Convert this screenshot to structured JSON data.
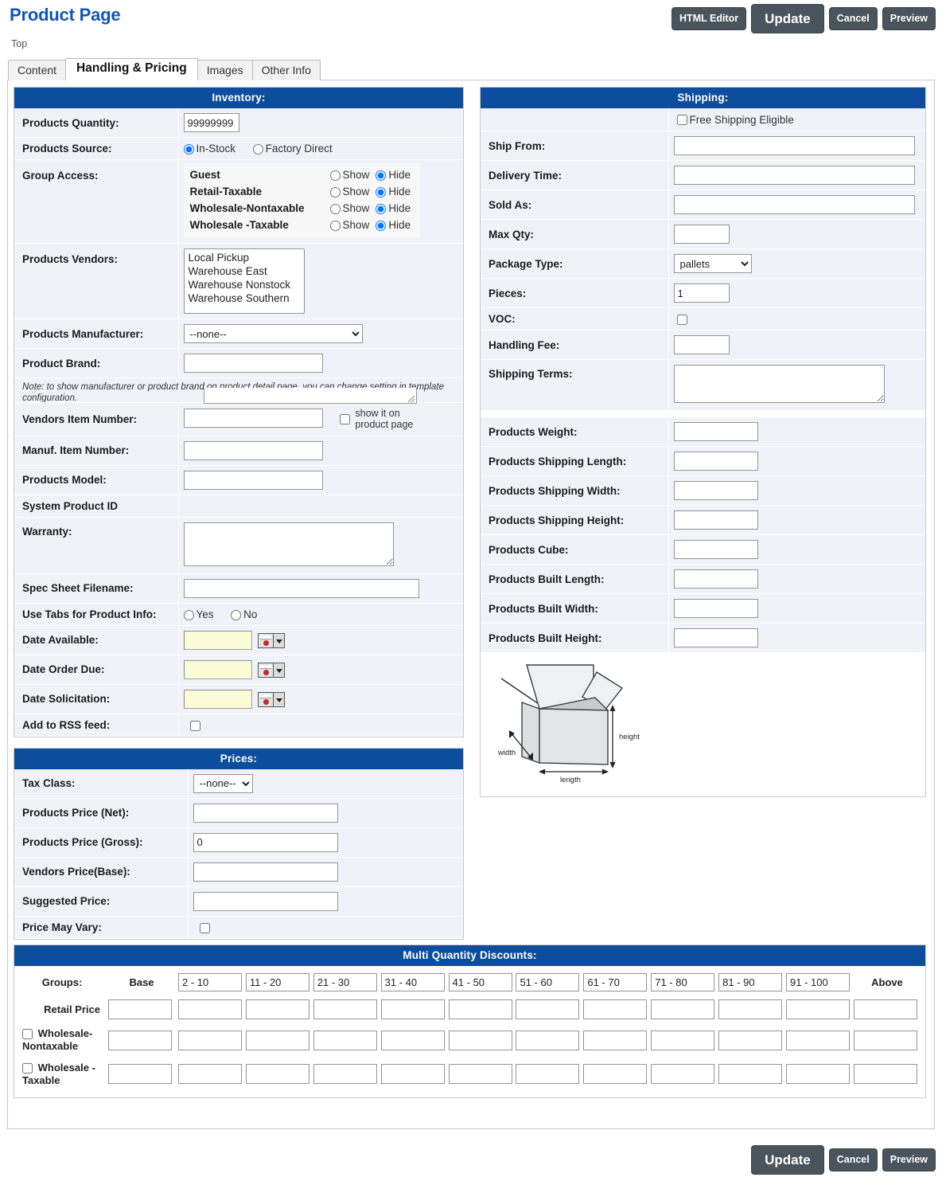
{
  "header": {
    "title": "Product Page",
    "breadcrumb": "Top",
    "buttons": {
      "html_editor": "HTML Editor",
      "update": "Update",
      "cancel": "Cancel",
      "preview": "Preview"
    }
  },
  "tabs": [
    {
      "label": "Content",
      "active": false
    },
    {
      "label": "Handling & Pricing",
      "active": true
    },
    {
      "label": "Images",
      "active": false
    },
    {
      "label": "Other Info",
      "active": false
    }
  ],
  "inventory": {
    "heading": "Inventory:",
    "products_quantity": {
      "label": "Products Quantity:",
      "value": "99999999"
    },
    "products_source": {
      "label": "Products Source:",
      "options": [
        "In-Stock",
        "Factory Direct"
      ],
      "selected": "In-Stock"
    },
    "group_access": {
      "label": "Group Access:",
      "show_label": "Show",
      "hide_label": "Hide",
      "rows": [
        {
          "name": "Guest",
          "selected": "Hide"
        },
        {
          "name": "Retail-Taxable",
          "selected": "Hide"
        },
        {
          "name": "Wholesale-Nontaxable",
          "selected": "Hide"
        },
        {
          "name": "Wholesale -Taxable",
          "selected": "Hide"
        }
      ]
    },
    "products_vendors": {
      "label": "Products Vendors:",
      "options": [
        "Local Pickup",
        "Warehouse East",
        "Warehouse Nonstock",
        "Warehouse Southern"
      ]
    },
    "products_manufacturer": {
      "label": "Products Manufacturer:",
      "value": "--none--"
    },
    "product_brand": {
      "label": "Product Brand:",
      "value": ""
    },
    "note": "Note: to show manufacturer or product brand on product detail page, you can change setting in template configuration.",
    "vendors_item_number": {
      "label": "Vendors Item Number:",
      "value": "",
      "checkbox_label": "show it on product page",
      "checked": false
    },
    "manuf_item_number": {
      "label": "Manuf. Item Number:",
      "value": ""
    },
    "products_model": {
      "label": "Products Model:",
      "value": ""
    },
    "system_product_id": {
      "label": "System Product ID",
      "value": ""
    },
    "warranty": {
      "label": "Warranty:",
      "value": ""
    },
    "spec_sheet_filename": {
      "label": "Spec Sheet Filename:",
      "value": ""
    },
    "use_tabs": {
      "label": "Use Tabs for Product Info:",
      "options": [
        "Yes",
        "No"
      ],
      "selected": ""
    },
    "date_available": {
      "label": "Date Available:",
      "value": ""
    },
    "date_order_due": {
      "label": "Date Order Due:",
      "value": ""
    },
    "date_solicitation": {
      "label": "Date Solicitation:",
      "value": ""
    },
    "add_to_rss": {
      "label": "Add to RSS feed:",
      "checked": false
    }
  },
  "prices": {
    "heading": "Prices:",
    "tax_class": {
      "label": "Tax Class:",
      "value": "--none--"
    },
    "price_net": {
      "label": "Products Price (Net):",
      "value": ""
    },
    "price_gross": {
      "label": "Products Price (Gross):",
      "value": "0"
    },
    "vendors_price_base": {
      "label": "Vendors Price(Base):",
      "value": ""
    },
    "suggested_price": {
      "label": "Suggested Price:",
      "value": ""
    },
    "price_may_vary": {
      "label": "Price May Vary:",
      "checked": false
    }
  },
  "shipping": {
    "heading": "Shipping:",
    "free_shipping": {
      "label": "Free Shipping Eligible",
      "checked": false
    },
    "ship_from": {
      "label": "Ship From:",
      "value": ""
    },
    "delivery_time": {
      "label": "Delivery Time:",
      "value": ""
    },
    "sold_as": {
      "label": "Sold As:",
      "value": ""
    },
    "max_qty": {
      "label": "Max Qty:",
      "value": ""
    },
    "package_type": {
      "label": "Package Type:",
      "value": "pallets"
    },
    "pieces": {
      "label": "Pieces:",
      "value": "1"
    },
    "voc": {
      "label": "VOC:",
      "checked": false
    },
    "handling_fee": {
      "label": "Handling Fee:",
      "value": ""
    },
    "shipping_terms": {
      "label": "Shipping Terms:",
      "value": ""
    },
    "products_weight": {
      "label": "Products Weight:",
      "value": ""
    },
    "shipping_length": {
      "label": "Products Shipping Length:",
      "value": ""
    },
    "shipping_width": {
      "label": "Products Shipping Width:",
      "value": ""
    },
    "shipping_height": {
      "label": "Products Shipping Height:",
      "value": ""
    },
    "products_cube": {
      "label": "Products Cube:",
      "value": ""
    },
    "built_length": {
      "label": "Products Built Length:",
      "value": ""
    },
    "built_width": {
      "label": "Products Built Width:",
      "value": ""
    },
    "built_height": {
      "label": "Products Built Height:",
      "value": ""
    },
    "diagram": {
      "height": "height",
      "width": "width",
      "length": "length"
    }
  },
  "discounts": {
    "heading": "Multi Quantity Discounts:",
    "groups_label": "Groups:",
    "base_label": "Base",
    "above_label": "Above",
    "ranges": [
      "2 - 10",
      "11 - 20",
      "21 - 30",
      "31 - 40",
      "41 - 50",
      "51 - 60",
      "61 - 70",
      "71 - 80",
      "81 - 90",
      "91 - 100"
    ],
    "rows": [
      {
        "label": "Retail Price",
        "checkbox": false,
        "values": [
          "",
          "",
          "",
          "",
          "",
          "",
          "",
          "",
          "",
          "",
          "",
          ""
        ]
      },
      {
        "label": "Wholesale-Nontaxable",
        "checkbox": true,
        "checked": false,
        "values": [
          "",
          "",
          "",
          "",
          "",
          "",
          "",
          "",
          "",
          "",
          "",
          ""
        ]
      },
      {
        "label": "Wholesale - Taxable",
        "checkbox": true,
        "checked": false,
        "values": [
          "",
          "",
          "",
          "",
          "",
          "",
          "",
          "",
          "",
          "",
          "",
          ""
        ]
      }
    ]
  },
  "footer": {
    "update": "Update",
    "cancel": "Cancel",
    "preview": "Preview"
  },
  "colors": {
    "accent": "#0d4d9e",
    "title": "#1155bb",
    "button": "#4a545c",
    "row_bg": "#f1f1f9"
  }
}
